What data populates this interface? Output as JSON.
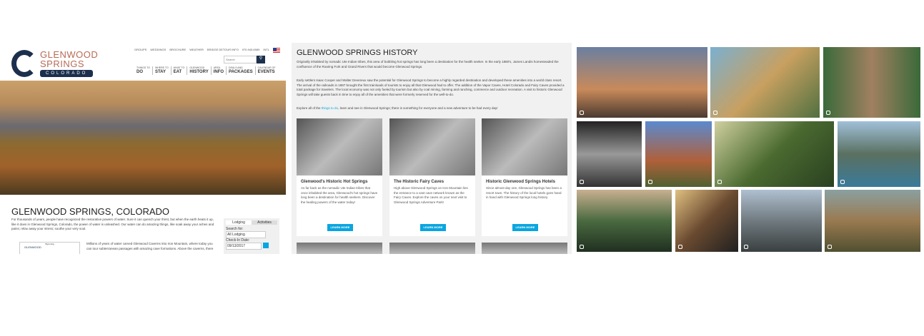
{
  "site1": {
    "logo": {
      "line1": "GLENWOOD",
      "line2": "SPRINGS",
      "badge": "COLORADO"
    },
    "utility_links": [
      "GROUPS",
      "WEDDINGS",
      "BROCHURE",
      "WEATHER",
      "BRIDGE DETOUR INFO",
      "970.945.6589",
      "INTL"
    ],
    "search_placeholder": "Search",
    "nav": [
      {
        "top": "THINGS TO",
        "main": "DO"
      },
      {
        "top": "WHERE TO",
        "main": "STAY"
      },
      {
        "top": "WHAT TO",
        "main": "EAT"
      },
      {
        "top": "GLENWOOD",
        "main": "HISTORY"
      },
      {
        "top": "AREA",
        "main": "INFO"
      },
      {
        "top": "DEALS AND",
        "main": "PACKAGES"
      },
      {
        "top": "CALENDAR OF",
        "main": "EVENTS"
      }
    ],
    "title": "GLENWOOD SPRINGS, COLORADO",
    "intro": "For thousands of years, people have recognized the restorative powers of water. Sure it can quench your thirst, but when the earth heats it up, like it does in Glenwood Springs, Colorado, the power of water is unleashed. Our water can do amazing things, like soak away your aches and pains; relax away your stress; soothe your very soul.",
    "para2": "Millions of years of water carved Glenwood Caverns into Iron Mountain, where today you can tour subterranean passages with amazing cave formations. Above the caverns, there",
    "map_label": "GLENWOOD",
    "map_title": "Wyoming",
    "widget": {
      "tabs": [
        "Lodging",
        "Activities"
      ],
      "search_label": "Search for:",
      "search_value": "All Lodging",
      "checkin_label": "Check-In Date:",
      "checkin_value": "09/13/2017"
    }
  },
  "site2": {
    "title": "GLENWOOD SPRINGS HISTORY",
    "p1": "Originally inhabited by nomadic Ute Indian tribes, this area of bubbling hot springs has long been a destination for the health seeker. In the early 1880's, James Landis homesteaded the confluence of the Roaring Fork and Grand Rivers that would become Glenwood Springs.",
    "p2": "Early settlers Isaac Cooper and Walter Devereux saw the potential for Glenwood Springs to become a highly regarded destination and developed these amenities into a world class resort. The arrival of the railroads in 1887 brought the first trainloads of tourists to enjoy all that Glenwood had to offer. The addition of the Vapor Caves, Hotel Colorado and Fairy Caves provided a total package for travelers. The local economy was not only fueled by tourism but also by coal mining, farming and ranching, commerce and outdoor recreation. A visit to historic Glenwood Springs will take guests back in time to enjoy all of the amenities that were formerly reserved for the well-to-do.",
    "p3_pre": "Explore all of the ",
    "p3_link": "things to do",
    "p3_post": ", learn and see in Glenwood Springs; there is something for everyone and a new adventure to be had every day!",
    "cards": [
      {
        "title": "Glenwood's Historic Hot Springs",
        "text": "As far back as the nomadic Ute Indian tribes that once inhabited the area, Glenwood's hot springs have long been a destination for health seekers. Discover the healing powers of the water today!",
        "button": "LEARN MORE"
      },
      {
        "title": "The Historic Fairy Caves",
        "text": "High above Glenwood Springs on Iron Mountain lies the entrance to a vast cave network known as the Fairy Caves. Explore the caves on your next visit to Glenwood Springs Adventure Park!",
        "button": "LEARN MORE"
      },
      {
        "title": "Historic Glenwood Springs Hotels",
        "text": "Since almost day one, Glenwood Springs has been a resort town. The history of the local hotels goes hand in hand with Glenwood Springs long history.",
        "button": "LEARN MORE"
      }
    ]
  },
  "gallery": {
    "icon": "instagram-icon",
    "tiles": 12
  }
}
